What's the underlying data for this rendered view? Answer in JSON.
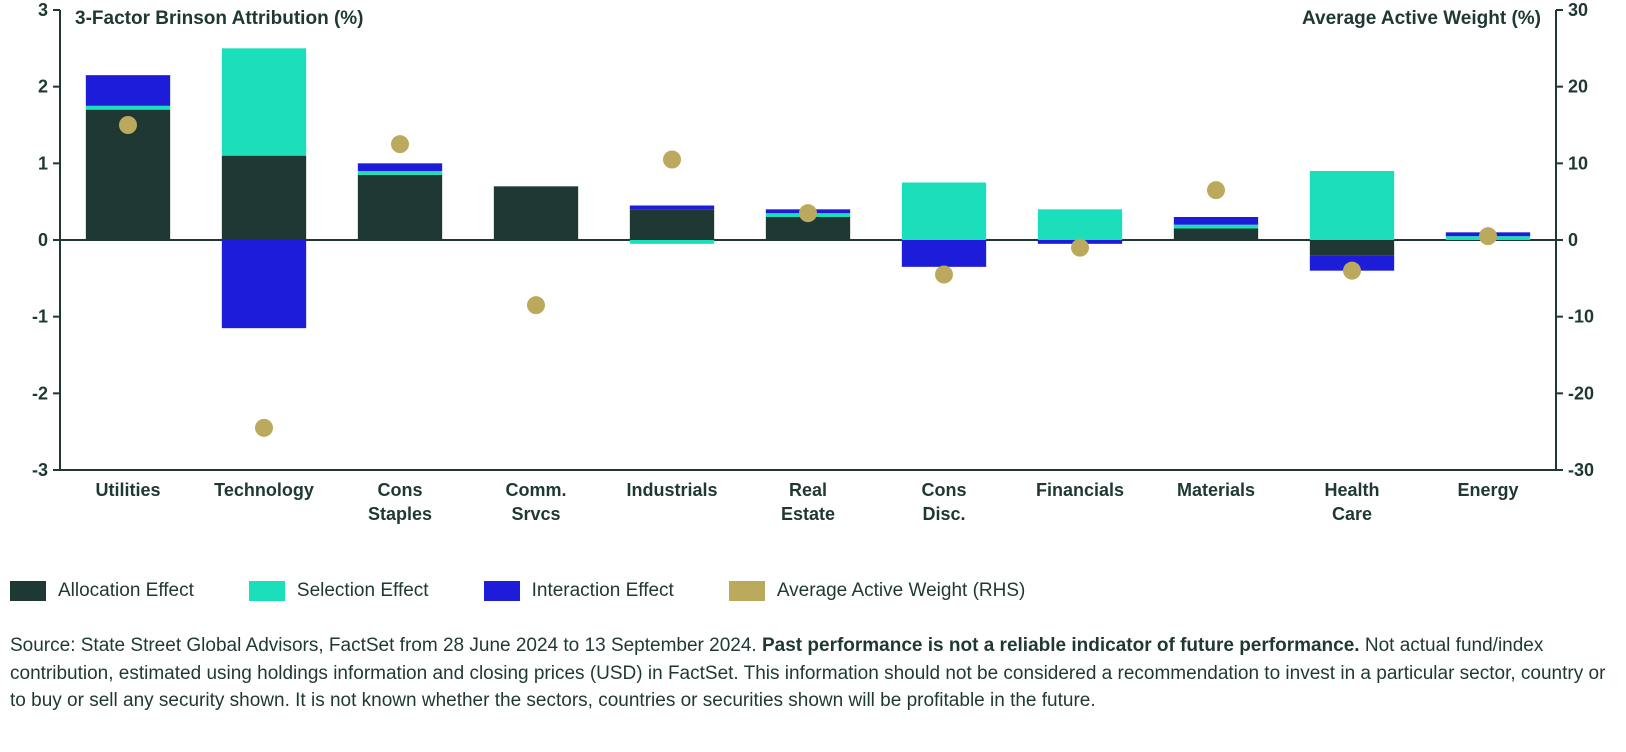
{
  "chart_data": {
    "type": "bar",
    "title_left": "3-Factor Brinson Attribution (%)",
    "title_right": "Average Active Weight (%)",
    "categories": [
      "Utilities",
      "Technology",
      "Cons Staples",
      "Comm. Srvcs",
      "Industrials",
      "Real Estate",
      "Cons Disc.",
      "Financials",
      "Materials",
      "Health Care",
      "Energy"
    ],
    "series": [
      {
        "name": "Allocation Effect",
        "color": "#1f3833",
        "values": [
          1.7,
          1.1,
          0.85,
          0.7,
          0.4,
          0.3,
          0.0,
          0.0,
          0.15,
          -0.2,
          0.0
        ]
      },
      {
        "name": "Selection Effect",
        "color": "#1bdfba",
        "values": [
          0.05,
          1.4,
          0.05,
          0.0,
          -0.05,
          0.05,
          0.75,
          0.4,
          0.05,
          0.9,
          0.05
        ]
      },
      {
        "name": "Interaction Effect",
        "color": "#1d1cd8",
        "values": [
          0.4,
          -1.15,
          0.1,
          0.0,
          0.05,
          0.05,
          -0.35,
          -0.05,
          0.1,
          -0.2,
          0.05
        ]
      }
    ],
    "scatter": {
      "name": "Average Active Weight (RHS)",
      "color": "#bbaa5d",
      "values": [
        15.0,
        -24.5,
        12.5,
        -8.5,
        10.5,
        3.5,
        -4.5,
        -1.0,
        6.5,
        -4.0,
        0.5
      ]
    },
    "ylim_left": [
      -3,
      3
    ],
    "ylim_right": [
      -30,
      30
    ],
    "yticks_left": [
      -3,
      -2,
      -1,
      0,
      1,
      2,
      3
    ],
    "yticks_right": [
      -30,
      -20,
      -10,
      0,
      10,
      20,
      30
    ],
    "xlabel": "",
    "ylabel_left": "3-Factor Brinson Attribution (%)",
    "ylabel_right": "Average Active Weight (%)"
  },
  "legend": {
    "items": [
      {
        "label": "Allocation  Effect",
        "color": "#1f3833"
      },
      {
        "label": "Selection Effect",
        "color": "#1bdfba"
      },
      {
        "label": "Interaction Effect",
        "color": "#1d1cd8"
      },
      {
        "label": "Average Active Weight (RHS)",
        "color": "#bbaa5d"
      }
    ]
  },
  "footnote": {
    "prefix": "Source: State Street Global Advisors, FactSet from 28 June 2024 to 13 September 2024. ",
    "bold": "Past performance is not a reliable indicator of future performance.",
    "suffix": " Not actual fund/index contribution, estimated using holdings information and closing prices (USD) in FactSet. This information should not be considered a recommendation to invest in a particular sector, country or to buy or sell any security shown. It is not known whether the sectors, countries or securities shown will be profitable in the future."
  }
}
